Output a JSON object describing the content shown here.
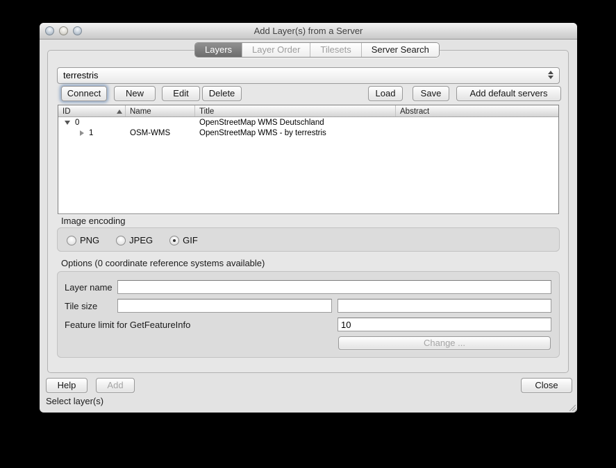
{
  "window": {
    "title": "Add Layer(s) from a Server",
    "status_text": "Select layer(s)"
  },
  "tabs": [
    {
      "label": "Layers",
      "state": "selected"
    },
    {
      "label": "Layer Order",
      "state": "disabled"
    },
    {
      "label": "Tilesets",
      "state": "disabled"
    },
    {
      "label": "Server Search",
      "state": "enabled"
    }
  ],
  "server_combo": {
    "value": "terrestris"
  },
  "toolbar": {
    "connect_label": "Connect",
    "new_label": "New",
    "edit_label": "Edit",
    "delete_label": "Delete",
    "load_label": "Load",
    "save_label": "Save",
    "add_default_label": "Add default servers"
  },
  "layers_table": {
    "columns": [
      "ID",
      "Name",
      "Title",
      "Abstract"
    ],
    "rows": [
      {
        "id": "0",
        "name": "",
        "title": "OpenStreetMap WMS Deutschland",
        "abstract": "",
        "expanded": true
      },
      {
        "id": "1",
        "name": "OSM-WMS",
        "title": "OpenStreetMap WMS - by terrestris",
        "abstract": "",
        "expanded": false
      }
    ]
  },
  "image_encoding": {
    "label": "Image encoding",
    "options": [
      "PNG",
      "JPEG",
      "GIF"
    ],
    "selected": "GIF"
  },
  "options_section": {
    "label": "Options (0 coordinate reference systems available)",
    "layer_name_label": "Layer name",
    "layer_name_value": "",
    "tile_size_label": "Tile size",
    "tile_width_value": "",
    "tile_height_value": "",
    "feature_limit_label": "Feature limit for GetFeatureInfo",
    "feature_limit_value": "10",
    "change_label": "Change ..."
  },
  "footer": {
    "help_label": "Help",
    "add_label": "Add",
    "close_label": "Close"
  },
  "colors": {
    "selected_tab_bg": "#6d6d6d",
    "focus_ring": "#7391b9",
    "dialog_bg": "#e3e3e3",
    "groupbox_bg": "#dcdcdc"
  }
}
